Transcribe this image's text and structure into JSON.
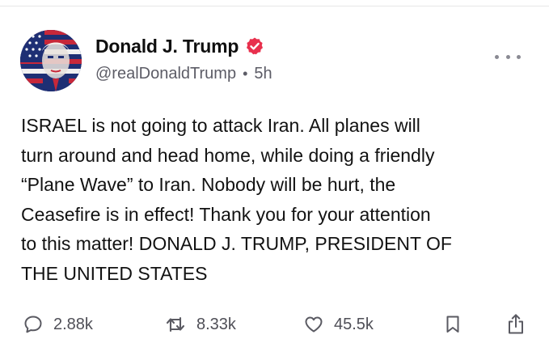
{
  "post": {
    "author": {
      "display_name": "Donald J. Trump",
      "handle": "@realDonaldTrump",
      "time": "5h",
      "verified_color": "#e8304d"
    },
    "body": "ISRAEL is not going to attack Iran. All planes will\nturn around and head home, while doing a friendly\n“Plane Wave” to Iran. Nobody will be hurt, the\nCeasefire is in effect! Thank you for your attention\nto this matter! DONALD J. TRUMP, PRESIDENT OF\nTHE UNITED STATES",
    "stats": {
      "replies": "2.88k",
      "reposts": "8.33k",
      "likes": "45.5k"
    },
    "separator": "•"
  },
  "icons": {
    "avatar": "flag-portrait-avatar",
    "verified": "verified-badge-icon",
    "more": "more-horizontal-icon",
    "reply": "speech-bubble-icon",
    "repost": "repost-arrows-icon",
    "like": "heart-icon",
    "bookmark": "bookmark-icon",
    "share": "share-upload-icon"
  },
  "colors": {
    "text": "#121212",
    "secondary_text": "#5c5c66",
    "icon": "#5a5a62"
  }
}
